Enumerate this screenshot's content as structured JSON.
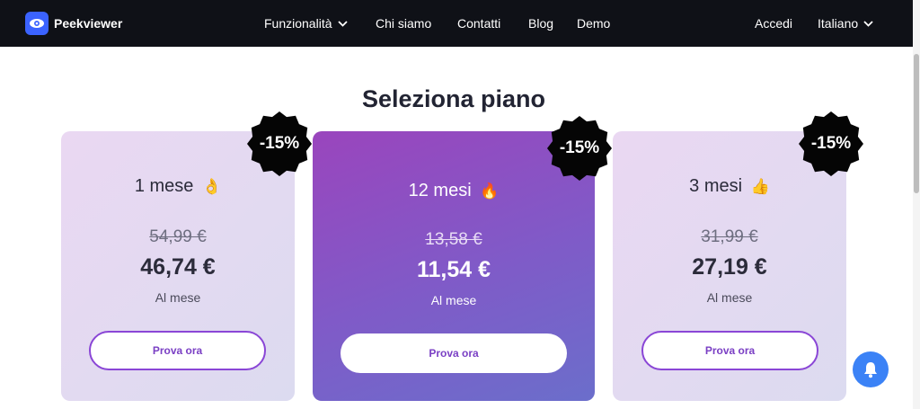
{
  "nav": {
    "brand": "Peekviewer",
    "items": [
      {
        "label": "Funzionalità"
      },
      {
        "label": "Chi siamo"
      },
      {
        "label": "Contatti"
      },
      {
        "label": "Blog"
      },
      {
        "label": "Demo"
      }
    ],
    "login": "Accedi",
    "language": "Italiano"
  },
  "heading": "Seleziona piano",
  "plans": [
    {
      "name": "1 mese",
      "emoji": "👌",
      "old_price": "54,99 €",
      "price": "46,74 €",
      "per": "Al mese",
      "cta": "Prova ora",
      "badge": "-15%"
    },
    {
      "name": "12 mesi",
      "emoji": "🔥",
      "old_price": "13,58 €",
      "price": "11,54 €",
      "per": "Al mese",
      "cta": "Prova ora",
      "badge": "-15%"
    },
    {
      "name": "3 mesi",
      "emoji": "👍",
      "old_price": "31,99 €",
      "price": "27,19 €",
      "per": "Al mese",
      "cta": "Prova ora",
      "badge": "-15%"
    }
  ],
  "colors": {
    "nav_bg": "#0f1117",
    "accent": "#8a46d6",
    "fab": "#3b82f6"
  },
  "icons": {
    "logo": "eye-icon",
    "fab": "bell-icon"
  }
}
